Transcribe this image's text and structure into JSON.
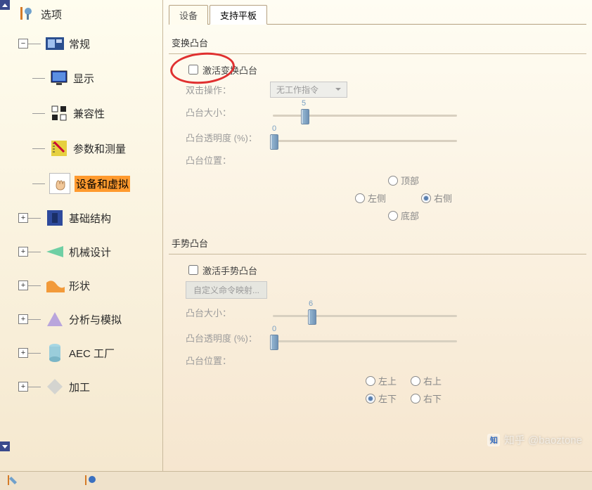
{
  "sidebar": {
    "root": "选项",
    "items": [
      {
        "label": "常规",
        "expanded": true
      },
      {
        "label": "显示"
      },
      {
        "label": "兼容性"
      },
      {
        "label": "参数和测量"
      },
      {
        "label": "设备和虚拟"
      },
      {
        "label": "基础结构"
      },
      {
        "label": "机械设计"
      },
      {
        "label": "形状"
      },
      {
        "label": "分析与模拟"
      },
      {
        "label": "AEC 工厂"
      },
      {
        "label": "加工"
      }
    ]
  },
  "tabs": {
    "active": 1,
    "items": [
      "设备",
      "支持平板"
    ]
  },
  "group1": {
    "title": "变换凸台",
    "checkbox_label": "激活变换凸台",
    "dblclick_label": "双击操作：",
    "dblclick_value": "无工作指令",
    "size_label": "凸台大小：",
    "size_value": 5,
    "opacity_label": "凸台透明度 (%)：",
    "opacity_value": 0,
    "pos_label": "凸台位置：",
    "radios": {
      "top": "顶部",
      "left": "左侧",
      "right": "右侧",
      "bottom": "底部"
    },
    "selected": "right"
  },
  "group2": {
    "title": "手势凸台",
    "checkbox_label": "激活手势凸台",
    "button_label": "自定义命令映射...",
    "size_label": "凸台大小：",
    "size_value": 6,
    "opacity_label": "凸台透明度 (%)：",
    "opacity_value": 0,
    "pos_label": "凸台位置：",
    "radios": {
      "tl": "左上",
      "tr": "右上",
      "bl": "左下",
      "br": "右下"
    },
    "selected": "bl"
  },
  "watermark": "知乎 @baoztone"
}
